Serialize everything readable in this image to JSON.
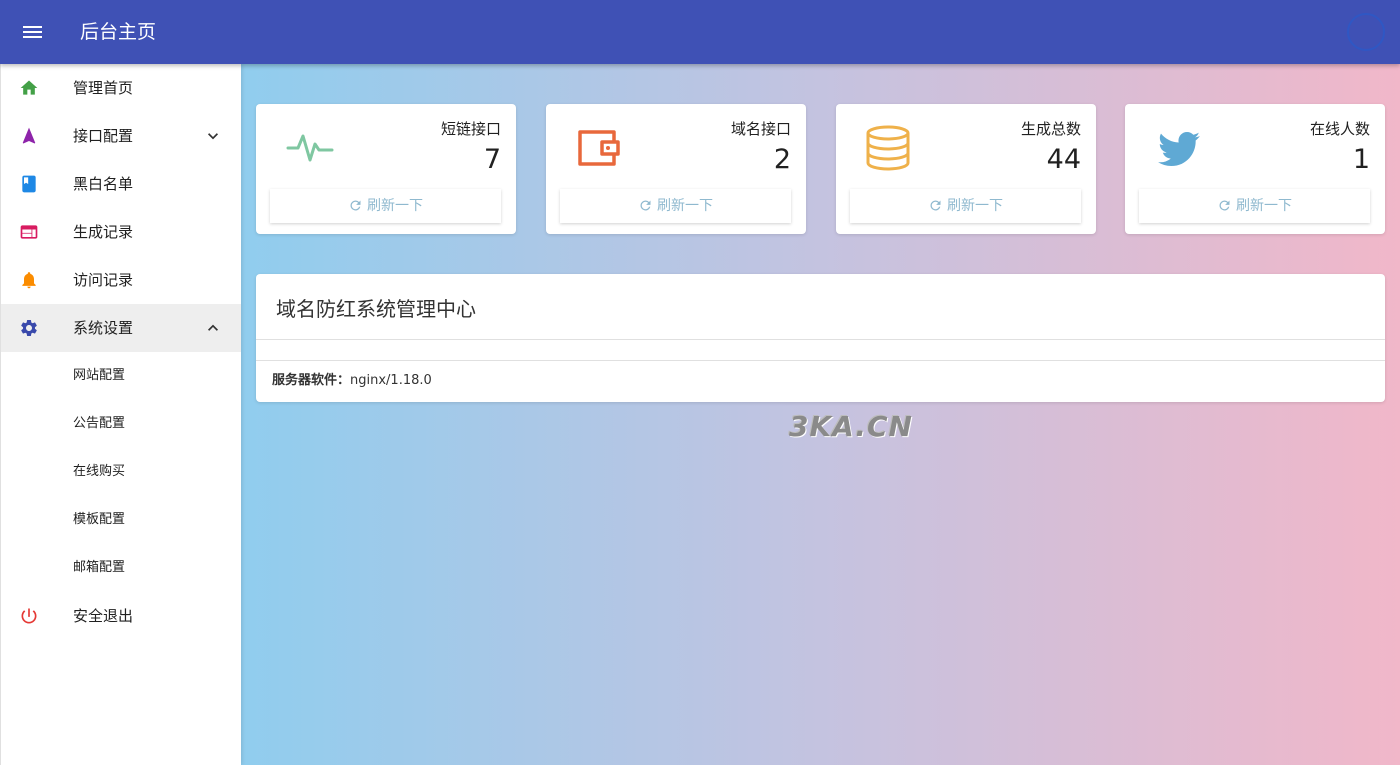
{
  "header": {
    "title": "后台主页"
  },
  "sidebar": {
    "items": [
      {
        "label": "管理首页",
        "icon": "home-icon",
        "color": "#43a047"
      },
      {
        "label": "接口配置",
        "icon": "navigation-icon",
        "color": "#8e24aa",
        "expandable": true,
        "expanded": false
      },
      {
        "label": "黑白名单",
        "icon": "book-icon",
        "color": "#1e88e5"
      },
      {
        "label": "生成记录",
        "icon": "web-icon",
        "color": "#d81b60"
      },
      {
        "label": "访问记录",
        "icon": "bell-icon",
        "color": "#fb8c00"
      },
      {
        "label": "系统设置",
        "icon": "gear-icon",
        "color": "#3949ab",
        "expandable": true,
        "expanded": true,
        "active": true
      },
      {
        "label": "安全退出",
        "icon": "power-icon",
        "color": "#e53935"
      }
    ],
    "sub_items": [
      {
        "label": "网站配置"
      },
      {
        "label": "公告配置"
      },
      {
        "label": "在线购买"
      },
      {
        "label": "模板配置"
      },
      {
        "label": "邮箱配置"
      }
    ]
  },
  "cards": [
    {
      "label": "短链接口",
      "value": "7",
      "icon": "pulse-icon",
      "color": "#7fc7a1",
      "refresh": "刷新一下"
    },
    {
      "label": "域名接口",
      "value": "2",
      "icon": "wallet-icon",
      "color": "#e8683c",
      "refresh": "刷新一下"
    },
    {
      "label": "生成总数",
      "value": "44",
      "icon": "coins-icon",
      "color": "#efb14a",
      "refresh": "刷新一下"
    },
    {
      "label": "在线人数",
      "value": "1",
      "icon": "twitter-icon",
      "color": "#5fa9d4",
      "refresh": "刷新一下"
    }
  ],
  "panel": {
    "title": "域名防红系统管理中心",
    "server_label": "服务器软件：",
    "server_value": "nginx/1.18.0"
  },
  "watermark": "3KA.CN",
  "colors": {
    "appbar": "#3f51b5",
    "refresh_text": "#8fb9cf"
  }
}
